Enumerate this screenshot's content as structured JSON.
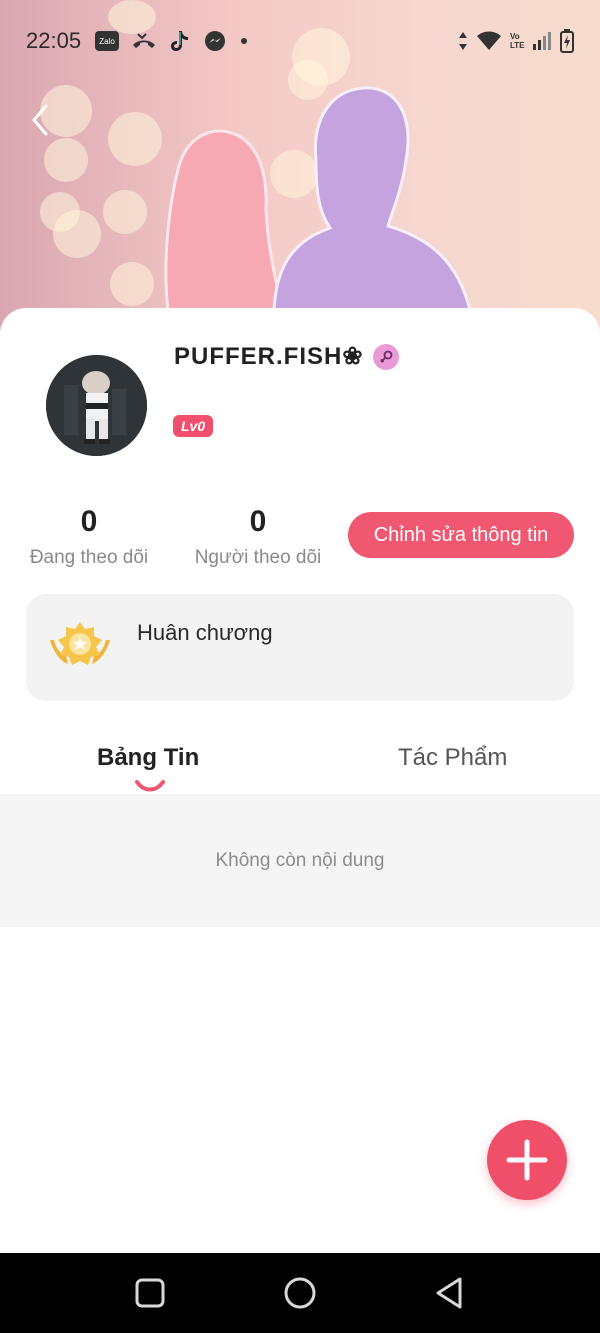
{
  "status_bar": {
    "time": "22:05",
    "icons": [
      "zalo-icon",
      "missed-call-icon",
      "tiktok-icon",
      "messenger-icon",
      "dot-icon",
      "data-arrows-icon",
      "wifi-icon",
      "volte-icon",
      "signal-icon",
      "battery-charging-icon"
    ],
    "zalo_label": "Zalo",
    "volte_label": "Vo LTE"
  },
  "header": {
    "back_icon": "chevron-left-icon"
  },
  "profile": {
    "username": "PUFFER.FISH❀",
    "gender_icon": "female-symbol-icon",
    "gender_color": "#ea9ad6",
    "level": "Lv0"
  },
  "stats": {
    "following": {
      "value": "0",
      "label": "Đang theo dõi"
    },
    "followers": {
      "value": "0",
      "label": "Người theo dõi"
    }
  },
  "edit_button": {
    "label": "Chỉnh sửa thông tin"
  },
  "medals": {
    "label": "Huân chương",
    "icon": "medal-icon"
  },
  "tabs": [
    {
      "label": "Bảng Tin",
      "active": true
    },
    {
      "label": "Tác Phẩm",
      "active": false
    }
  ],
  "feed": {
    "empty_text": "Không còn nội dung"
  },
  "fab": {
    "icon": "plus-icon"
  },
  "nav_bar": {
    "icons": [
      "recents-square-icon",
      "home-circle-icon",
      "back-triangle-icon"
    ]
  },
  "colors": {
    "accent": "#f05770",
    "fab": "#f04f6a",
    "level_badge": "#f0506e"
  }
}
